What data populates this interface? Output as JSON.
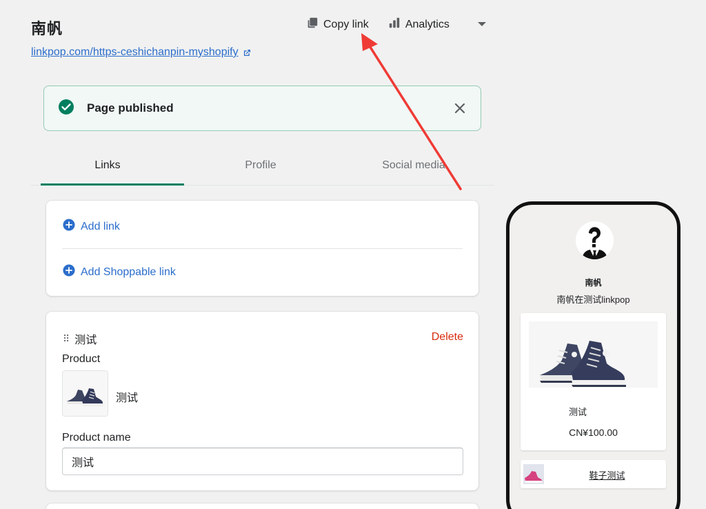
{
  "header": {
    "title": "南帆",
    "url": "linkpop.com/https-ceshichanpin-myshopify",
    "copy_link_label": "Copy link",
    "analytics_label": "Analytics"
  },
  "banner": {
    "text": "Page published"
  },
  "tabs": [
    {
      "label": "Links"
    },
    {
      "label": "Profile"
    },
    {
      "label": "Social media"
    }
  ],
  "add_card": {
    "add_link_label": "Add link",
    "add_shoppable_label": "Add Shoppable link"
  },
  "item_card": {
    "title": "测试",
    "delete_label": "Delete",
    "product_label": "Product",
    "product_title": "测试",
    "product_name_label": "Product name",
    "product_name_value": "测试"
  },
  "preview": {
    "name": "南帆",
    "bio": "南帆在测试linkpop",
    "product_name": "测试",
    "product_price": "CN¥100.00",
    "link_text": "鞋子测试"
  },
  "colors": {
    "accent": "#008060",
    "link": "#2c6ecb",
    "danger": "#d82c0d",
    "banner_bg": "#f1f8f5",
    "arrow": "#ef3b35"
  }
}
